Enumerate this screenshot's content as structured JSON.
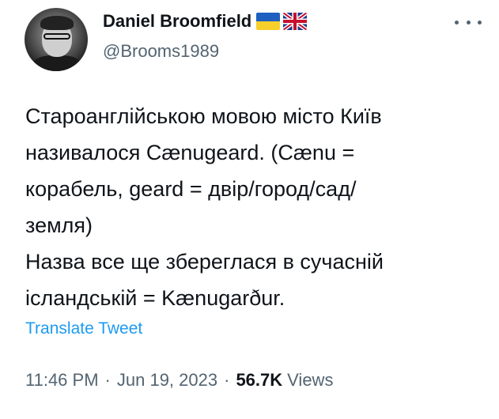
{
  "author": {
    "display_name": "Daniel Broomfield",
    "handle": "@Brooms1989",
    "flags": [
      "ukraine-flag-icon",
      "uk-flag-icon"
    ]
  },
  "tweet": {
    "lines": [
      "Староанглійською мовою місто Київ",
      "називалося Cænugeard. (Cænu =",
      "корабель, geard = двір/город/сад/",
      "земля)",
      "Назва все ще збереглася в сучасній",
      "ісландській = Kænugarður."
    ],
    "translate_label": "Translate Tweet",
    "time": "11:46 PM",
    "date": "Jun 19, 2023",
    "separator": "·",
    "views_count": "56.7K",
    "views_label": "Views"
  },
  "colors": {
    "text_primary": "#0f1419",
    "text_secondary": "#536471",
    "accent": "#1d9bf0"
  }
}
